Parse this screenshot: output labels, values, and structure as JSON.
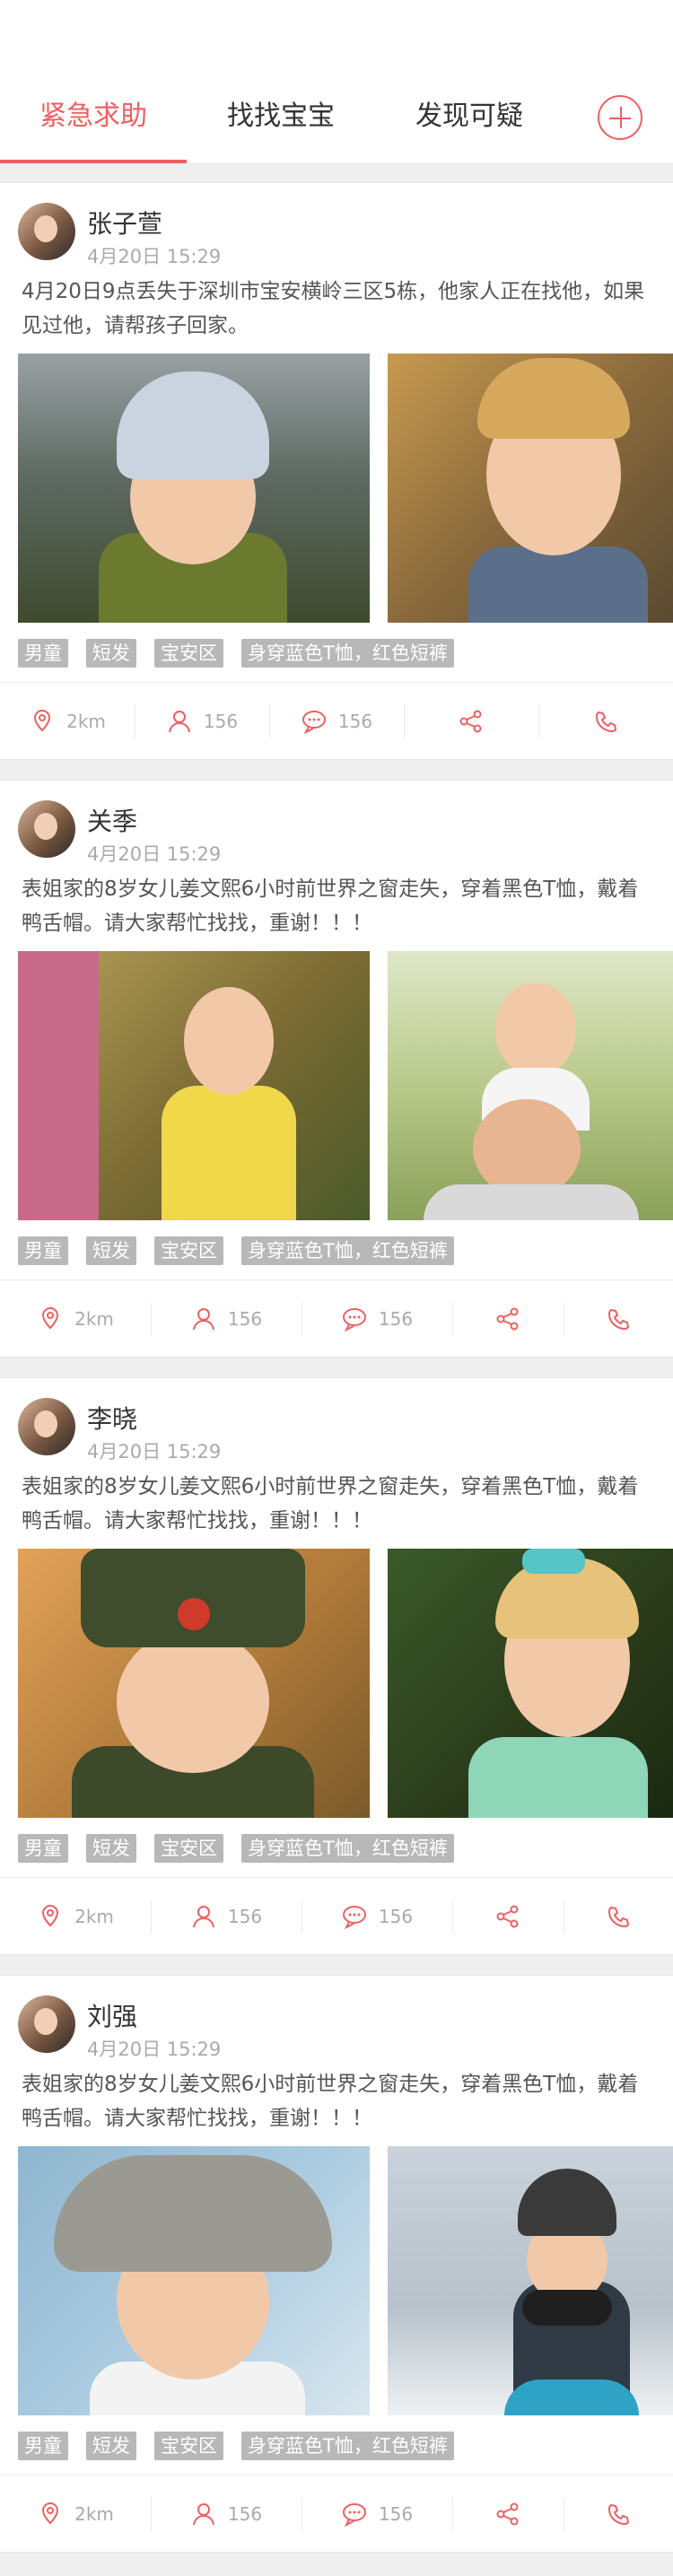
{
  "tabs": [
    {
      "label": "紧急求助",
      "active": true
    },
    {
      "label": "找找宝宝",
      "active": false
    },
    {
      "label": "发现可疑",
      "active": false
    }
  ],
  "accent_color": "#ef5f61",
  "posts": [
    {
      "name": "张子萱",
      "time": "4月20日 15:29",
      "desc": "4月20日9点丢失于深圳市宝安横岭三区5栋，他家人正在找他，如果见过他，请帮孩子回家。",
      "tags": [
        "男童",
        "短发",
        "宝安区",
        "身穿蓝色T恤，红色短裤"
      ],
      "distance": "2km",
      "followers": "156",
      "comments": "156"
    },
    {
      "name": "关季",
      "time": "4月20日 15:29",
      "desc": "表姐家的8岁女儿姜文熙6小时前世界之窗走失，穿着黑色T恤，戴着鸭舌帽。请大家帮忙找找，重谢！！！",
      "tags": [
        "男童",
        "短发",
        "宝安区",
        "身穿蓝色T恤，红色短裤"
      ],
      "distance": "2km",
      "followers": "156",
      "comments": "156"
    },
    {
      "name": "李晓",
      "time": "4月20日 15:29",
      "desc": "表姐家的8岁女儿姜文熙6小时前世界之窗走失，穿着黑色T恤，戴着鸭舌帽。请大家帮忙找找，重谢！！！",
      "tags": [
        "男童",
        "短发",
        "宝安区",
        "身穿蓝色T恤，红色短裤"
      ],
      "distance": "2km",
      "followers": "156",
      "comments": "156"
    },
    {
      "name": "刘强",
      "time": "4月20日 15:29",
      "desc": "表姐家的8岁女儿姜文熙6小时前世界之窗走失，穿着黑色T恤，戴着鸭舌帽。请大家帮忙找找，重谢！！！",
      "tags": [
        "男童",
        "短发",
        "宝安区",
        "身穿蓝色T恤，红色短裤"
      ],
      "distance": "2km",
      "followers": "156",
      "comments": "156"
    }
  ]
}
